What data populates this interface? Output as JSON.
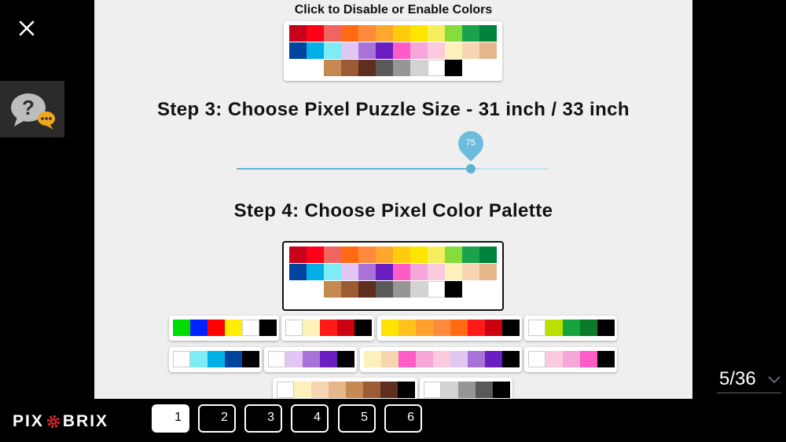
{
  "colors": {
    "accent": "#5fb4d4",
    "dark": "#000000",
    "panel": "#efefef"
  },
  "icons": {
    "close": "close-icon",
    "help": "help-chat-icon",
    "counter_chevron": "chevron-down-icon",
    "logo_gear": "gear-icon"
  },
  "main": {
    "toggle_header": "Click to Disable or Enable Colors",
    "step3_title": "Step 3: Choose Pixel Puzzle Size - 31 inch / 33 inch",
    "slider_value": "75",
    "slider_fraction": 0.75,
    "step4_title": "Step 4: Choose Pixel Color Palette"
  },
  "palettes": {
    "full": [
      [
        "#c8001a",
        "#ff0019",
        "#f06560",
        "#ff6a13",
        "#ff8a3d",
        "#ffa72d",
        "#ffcc0d",
        "#ffe400",
        "#f6ee5e",
        "#86dc3d",
        "#1aa34a",
        "#00843d"
      ],
      [
        "#0044a0",
        "#00b0e6",
        "#7eecf4",
        "#e1c6f4",
        "#a972d8",
        "#6a1ec2",
        "#ff5cc8",
        "#f6a6d8",
        "#fbcade",
        "#fdf0ba",
        "#f6d6b2",
        "#e5b68a"
      ],
      [
        "#c48a52",
        "#9b5c35",
        "#5e2e1e",
        "#595959",
        "#969696",
        "#d3d3d3",
        "#ffffff",
        "#000000"
      ]
    ],
    "options": [
      [
        "#00dd00",
        "#0022ff",
        "#ff0000",
        "#ffee00",
        "#ffffff",
        "#000000"
      ],
      [
        "#ffffff",
        "#fff2b8",
        "#ff1a1a",
        "#cc0011",
        "#000000"
      ],
      [
        "#ffe400",
        "#ffc11e",
        "#ffa02d",
        "#ff8a3d",
        "#ff6a13",
        "#ff1a1a",
        "#cc0011",
        "#000000"
      ],
      [
        "#ffffff",
        "#bbe000",
        "#17a33c",
        "#0a7a2a",
        "#000000"
      ],
      [
        "#ffffff",
        "#7eecf4",
        "#00b0e6",
        "#0044a0",
        "#000000"
      ],
      [
        "#ffffff",
        "#e1c6f4",
        "#a972d8",
        "#6a1ec2",
        "#000000"
      ],
      [
        "#fdf0ba",
        "#f6d6b2",
        "#ff5cc8",
        "#f6a6d8",
        "#fbcade",
        "#e1c6f4",
        "#a972d8",
        "#6a1ec2",
        "#000000"
      ],
      [
        "#ffffff",
        "#fbcade",
        "#f6a6d8",
        "#ff5cc8",
        "#000000"
      ],
      [
        "#ffffff",
        "#fdf0ba",
        "#f6d6b2",
        "#e5b68a",
        "#c48a52",
        "#9b5c35",
        "#5e2e1e",
        "#000000"
      ],
      [
        "#ffffff",
        "#d3d3d3",
        "#969696",
        "#595959",
        "#000000"
      ]
    ]
  },
  "pager": {
    "counter": "5/36",
    "pages": [
      "1",
      "2",
      "3",
      "4",
      "5",
      "6"
    ],
    "active_page": 0
  },
  "logo": {
    "left": "PIX",
    "right": "BRIX"
  }
}
